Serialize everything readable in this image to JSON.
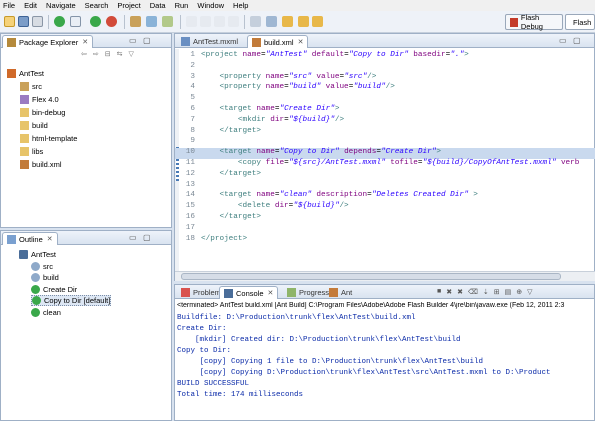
{
  "menu": [
    "File",
    "Edit",
    "Navigate",
    "Search",
    "Project",
    "Data",
    "Run",
    "Window",
    "Help"
  ],
  "toolbar": {
    "perspective_flash_debug": "Flash Debug",
    "perspective_flash": "Flash"
  },
  "package_explorer": {
    "title": "Package Explorer",
    "items": [
      {
        "label": "AntTest",
        "icon": "project-icon",
        "depth": 0
      },
      {
        "label": "src",
        "icon": "source-folder-icon",
        "depth": 1
      },
      {
        "label": "Flex 4.0",
        "icon": "library-icon",
        "depth": 1
      },
      {
        "label": "bin-debug",
        "icon": "folder-icon",
        "depth": 1
      },
      {
        "label": "build",
        "icon": "folder-icon",
        "depth": 1
      },
      {
        "label": "html-template",
        "icon": "folder-icon",
        "depth": 1
      },
      {
        "label": "libs",
        "icon": "folder-icon",
        "depth": 1
      },
      {
        "label": "build.xml",
        "icon": "xml-file-icon",
        "depth": 1
      }
    ]
  },
  "outline": {
    "title": "Outline",
    "items": [
      {
        "label": "AntTest",
        "depth": 0
      },
      {
        "label": "src",
        "depth": 1
      },
      {
        "label": "build",
        "depth": 1
      },
      {
        "label": "Create Dir",
        "depth": 1
      },
      {
        "label": "Copy to Dir [default]",
        "depth": 1
      },
      {
        "label": "clean",
        "depth": 1
      }
    ]
  },
  "editor": {
    "tabs": [
      "AntTest.mxml",
      "build.xml"
    ],
    "lines": [
      {
        "n": "1",
        "text": "<project name=\"AntTest\" default=\"Copy to Dir\" basedir=\".\">"
      },
      {
        "n": "2",
        "text": ""
      },
      {
        "n": "3",
        "text": "    <property name=\"src\" value=\"src\"/>"
      },
      {
        "n": "4",
        "text": "    <property name=\"build\" value=\"build\"/>"
      },
      {
        "n": "5",
        "text": ""
      },
      {
        "n": "6",
        "text": "    <target name=\"Create Dir\">"
      },
      {
        "n": "7",
        "text": "        <mkdir dir=\"${build}\"/>"
      },
      {
        "n": "8",
        "text": "    </target>"
      },
      {
        "n": "9",
        "text": ""
      },
      {
        "n": "10",
        "text": "    <target name=\"Copy to Dir\" depends=\"Create Dir\">"
      },
      {
        "n": "11",
        "text": "        <copy file=\"${src}/AntTest.mxml\" tofile=\"${build}/CopyOfAntTest.mxml\" verb"
      },
      {
        "n": "12",
        "text": "    </target>"
      },
      {
        "n": "13",
        "text": ""
      },
      {
        "n": "14",
        "text": "    <target name=\"clean\" description=\"Deletes Created Dir\" >"
      },
      {
        "n": "15",
        "text": "        <delete dir=\"${build}\"/>"
      },
      {
        "n": "16",
        "text": "    </target>"
      },
      {
        "n": "17",
        "text": ""
      },
      {
        "n": "18",
        "text": "</project>"
      }
    ]
  },
  "bottom": {
    "tabs": [
      "Problems",
      "Console",
      "Progress",
      "Ant"
    ],
    "status": "<terminated> AntTest build.xml [Ant Build] C:\\Program Files\\Adobe\\Adobe Flash Builder 4\\jre\\bin\\javaw.exe (Feb 12, 2011 2:3",
    "console_lines": [
      "Buildfile: D:\\Production\\trunk\\flex\\AntTest\\build.xml",
      "Create Dir:",
      "    [mkdir] Created dir: D:\\Production\\trunk\\flex\\AntTest\\build",
      "Copy to Dir:",
      "     [copy] Copying 1 file to D:\\Production\\trunk\\flex\\AntTest\\build",
      "     [copy] Copying D:\\Production\\trunk\\flex\\AntTest\\src\\AntTest.mxml to D:\\Product",
      "BUILD SUCCESSFUL",
      "Total time: 174 milliseconds"
    ]
  }
}
